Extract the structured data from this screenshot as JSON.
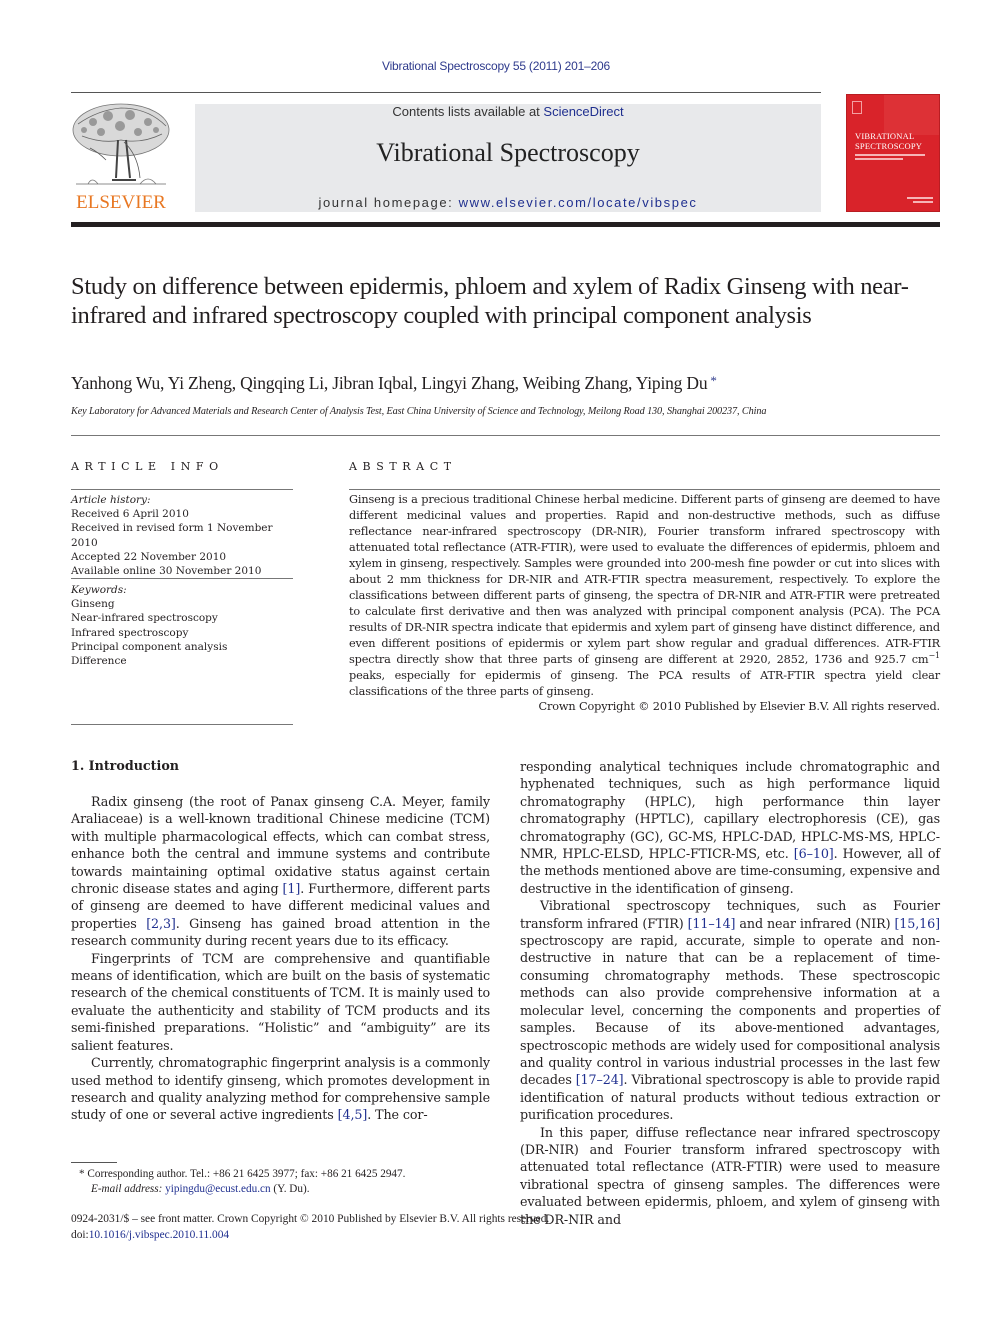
{
  "header": {
    "running_head": "Vibrational Spectroscopy 55 (2011) 201–206",
    "contents_prefix": "Contents lists available at ",
    "contents_link": "ScienceDirect",
    "journal_title": "Vibrational Spectroscopy",
    "homepage_prefix": "journal homepage: ",
    "homepage_link": "www.elsevier.com/locate/vibspec",
    "publisher_logo_text": "ELSEVIER",
    "cover_title_line1": "VIBRATIONAL",
    "cover_title_line2": "SPECTROSCOPY"
  },
  "article": {
    "title": "Study on difference between epidermis, phloem and xylem of Radix Ginseng with near-infrared and infrared spectroscopy coupled with principal component analysis",
    "authors": "Yanhong Wu, Yi Zheng, Qingqing Li, Jibran Iqbal, Lingyi Zhang, Weibing Zhang, Yiping Du",
    "corresponding_mark": "*",
    "affiliation": "Key Laboratory for Advanced Materials and Research Center of Analysis Test, East China University of Science and Technology, Meilong Road 130, Shanghai 200237, China"
  },
  "article_info": {
    "heading": "ARTICLE INFO",
    "history_label": "Article history:",
    "history": [
      "Received 6 April 2010",
      "Received in revised form 1 November 2010",
      "Accepted 22 November 2010",
      "Available online 30 November 2010"
    ],
    "keywords_label": "Keywords:",
    "keywords": [
      "Ginseng",
      "Near-infrared spectroscopy",
      "Infrared spectroscopy",
      "Principal component analysis",
      "Difference"
    ]
  },
  "abstract": {
    "heading": "ABSTRACT",
    "text_part1": "Ginseng is a precious traditional Chinese herbal medicine. Different parts of ginseng are deemed to have different medicinal values and properties. Rapid and non-destructive methods, such as diffuse reflectance near-infrared spectroscopy (DR-NIR), Fourier transform infrared spectroscopy with attenuated total reflectance (ATR-FTIR), were used to evaluate the differences of epidermis, phloem and xylem in ginseng, respectively. Samples were grounded into 200-mesh fine powder or cut into slices with about 2 mm thickness for DR-NIR and ATR-FTIR spectra measurement, respectively. To explore the classifications between different parts of ginseng, the spectra of DR-NIR and ATR-FTIR were pretreated to calculate first derivative and then was analyzed with principal component analysis (PCA). The PCA results of DR-NIR spectra indicate that epidermis and xylem part of ginseng have distinct difference, and even different positions of epidermis or xylem part show regular and gradual differences. ATR-FTIR spectra directly show that three parts of ginseng are different at 2920, 2852, 1736 and 925.7 cm",
    "superscript": "−1",
    "text_part2": " peaks, especially for epidermis of ginseng. The PCA results of ATR-FTIR spectra yield clear classifications of the three parts of ginseng.",
    "copyright": "Crown Copyright © 2010 Published by Elsevier B.V. All rights reserved."
  },
  "body": {
    "section_heading": "1.  Introduction",
    "left_paragraphs": [
      [
        {
          "t": "Radix ginseng (the root of Panax ginseng C.A. Meyer, family Araliaceae) is a well-known traditional Chinese medicine (TCM) with multiple pharmacological effects, which can combat stress, enhance both the central and immune systems and contribute towards maintaining optimal oxidative status against certain chronic disease states and aging "
        },
        {
          "r": "[1]"
        },
        {
          "t": ". Furthermore, different parts of ginseng are deemed to have different medicinal values and properties "
        },
        {
          "r": "[2,3]"
        },
        {
          "t": ". Ginseng has gained broad attention in the research community during recent years due to its efficacy."
        }
      ],
      [
        {
          "t": "Fingerprints of TCM are comprehensive and quantifiable means of identification, which are built on the basis of systematic research of the chemical constituents of TCM. It is mainly used to evaluate the authenticity and stability of TCM products and its semi-finished preparations. “Holistic” and “ambiguity” are its salient features."
        }
      ],
      [
        {
          "t": "Currently, chromatographic fingerprint analysis is a commonly used method to identify ginseng, which promotes development in research and quality analyzing method for comprehensive sample study of one or several active ingredients "
        },
        {
          "r": "[4,5]"
        },
        {
          "t": ". The cor-"
        }
      ]
    ],
    "right_paragraphs": [
      [
        {
          "t": "responding analytical techniques include chromatographic and hyphenated techniques, such as high performance liquid chromatography (HPLC), high performance thin layer chromatography (HPTLC), capillary electrophoresis (CE), gas chromatography (GC), GC-MS, HPLC-DAD, HPLC-MS-MS, HPLC-NMR, HPLC-ELSD, HPLC-FTICR-MS, etc. "
        },
        {
          "r": "[6–10]"
        },
        {
          "t": ". However, all of the methods mentioned above are time-consuming, expensive and destructive in the identification of ginseng."
        }
      ],
      [
        {
          "t": "Vibrational spectroscopy techniques, such as Fourier transform infrared (FTIR) "
        },
        {
          "r": "[11–14]"
        },
        {
          "t": " and near infrared (NIR) "
        },
        {
          "r": "[15,16]"
        },
        {
          "t": " spectroscopy are rapid, accurate, simple to operate and non-destructive in nature that can be a replacement of time-consuming chromatography methods. These spectroscopic methods can also provide comprehensive information at a molecular level, concerning the components and properties of samples. Because of its above-mentioned advantages, spectroscopic methods are widely used for compositional analysis and quality control in various industrial processes in the last few decades "
        },
        {
          "r": "[17–24]"
        },
        {
          "t": ". Vibrational spectroscopy is able to provide rapid identification of natural products without tedious extraction or purification procedures."
        }
      ],
      [
        {
          "t": "In this paper, diffuse reflectance near infrared spectroscopy (DR-NIR) and Fourier transform infrared spectroscopy with attenuated total reflectance (ATR-FTIR) were used to measure vibrational spectra of ginseng samples. The differences were evaluated between epidermis, phloem, and xylem of ginseng with the DR-NIR and"
        }
      ]
    ]
  },
  "footnote": {
    "mark": "*",
    "line1": " Corresponding author. Tel.: +86 21 6425 3977; fax: +86 21 6425 2947.",
    "email_label": "E-mail address: ",
    "email": "yipingdu@ecust.edu.cn",
    "email_suffix": " (Y. Du)."
  },
  "bottom": {
    "issn_line": "0924-2031/$ – see front matter. Crown Copyright © 2010 Published by Elsevier B.V. All rights reserved.",
    "doi_prefix": "doi:",
    "doi": "10.1016/j.vibspec.2010.11.004"
  },
  "colors": {
    "link": "#1f2f8f",
    "elsevier_orange": "#e87722",
    "cover_red": "#d9232a",
    "banner_gray": "#e8e9eb"
  }
}
